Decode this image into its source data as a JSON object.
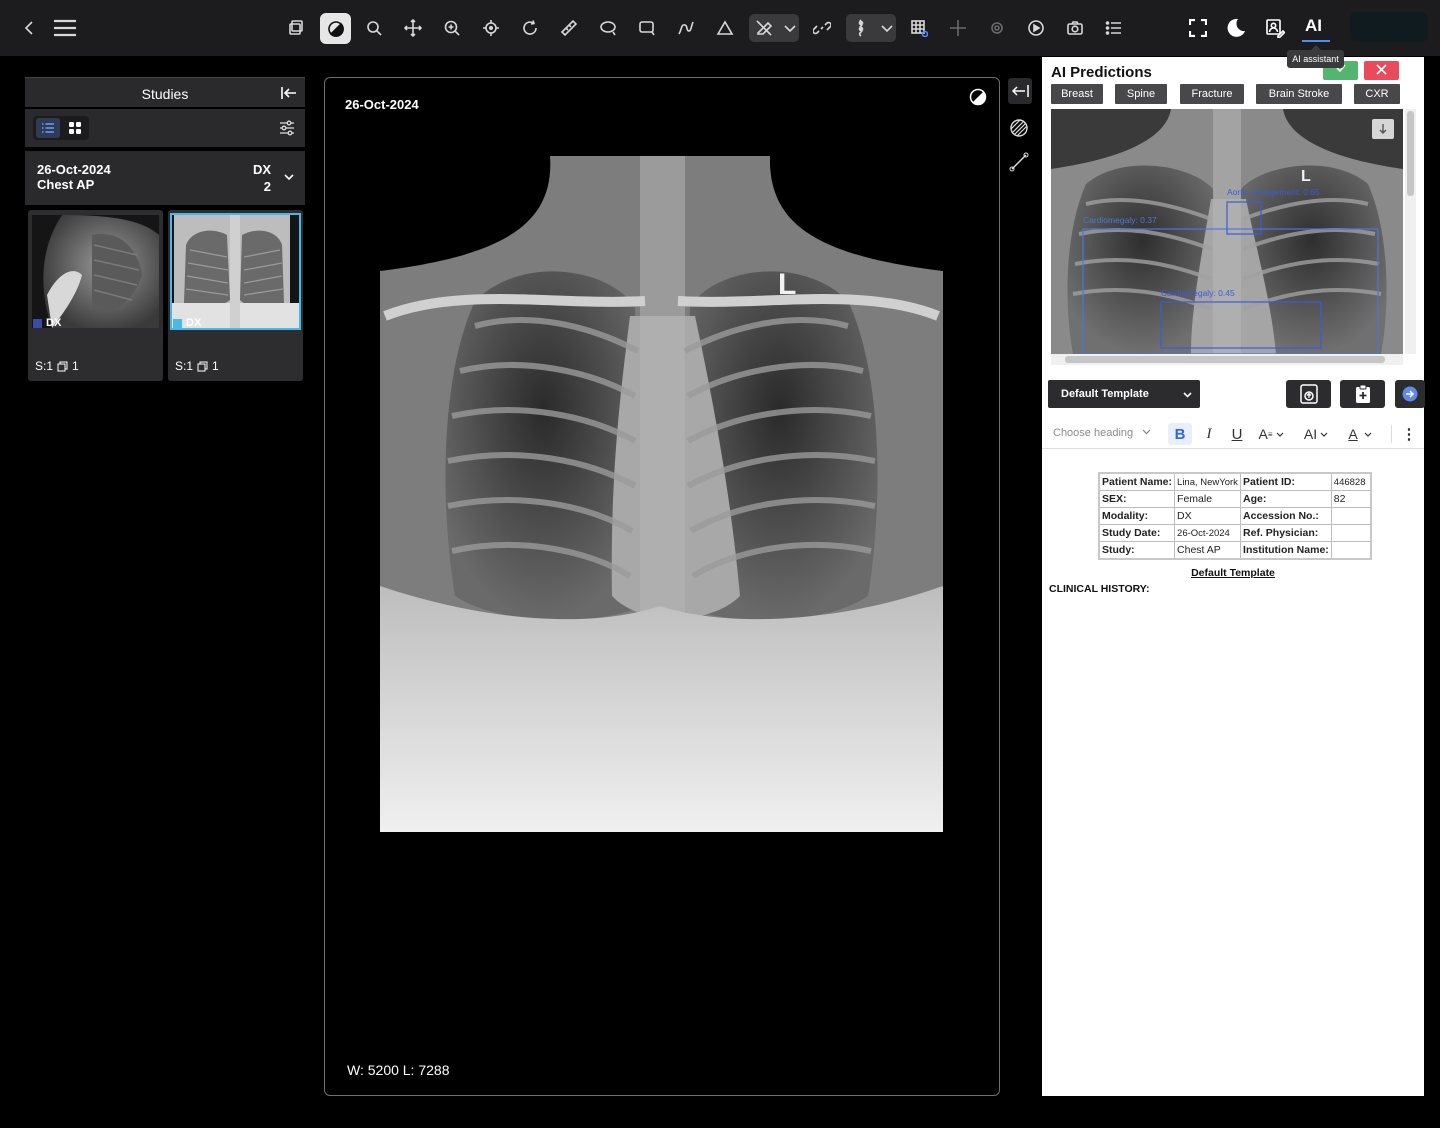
{
  "toolbar": {
    "ai_label": "AI",
    "ai_tooltip": "AI assistant"
  },
  "studies": {
    "title": "Studies",
    "card": {
      "date": "26-Oct-2024",
      "description": "Chest AP",
      "modality": "DX",
      "count": "2"
    },
    "thumbnails": [
      {
        "modality": "DX",
        "series": "S:1",
        "instances": "1",
        "color": "#3b4ba8"
      },
      {
        "modality": "DX",
        "series": "S:1",
        "instances": "1",
        "color": "#49b8e8"
      }
    ]
  },
  "viewer": {
    "date": "26-Oct-2024",
    "window_level": "W:  5200  L:  7288",
    "marker": "L"
  },
  "ai_panel": {
    "title": "AI Predictions",
    "models": [
      "Breast",
      "Spine",
      "Fracture",
      "Brain Stroke",
      "CXR"
    ],
    "predictions": [
      {
        "label": "Aortic enlargement: 0.65"
      },
      {
        "label": "Cardiomegaly: 0.37"
      },
      {
        "label": "Cardiomegaly: 0.45"
      }
    ],
    "template_select": "Default Template",
    "editor": {
      "heading_placeholder": "Choose heading"
    },
    "report": {
      "rows": [
        [
          "Patient Name:",
          "Lina, NewYork",
          "Patient ID:",
          "446828"
        ],
        [
          "SEX:",
          "Female",
          "Age:",
          "82"
        ],
        [
          "Modality:",
          "DX",
          "Accession No.:",
          ""
        ],
        [
          "Study Date:",
          "26-Oct-2024",
          "Ref. Physician:",
          ""
        ],
        [
          "Study:",
          "Chest AP",
          "Institution Name:",
          ""
        ]
      ],
      "template_heading": "Default Template",
      "clinical_history": "CLINICAL HISTORY:"
    }
  },
  "colors": {
    "accent": "#4d8df7",
    "confirm": "#54b571",
    "cancel": "#e94b5d",
    "box": "#3a5bd9"
  }
}
